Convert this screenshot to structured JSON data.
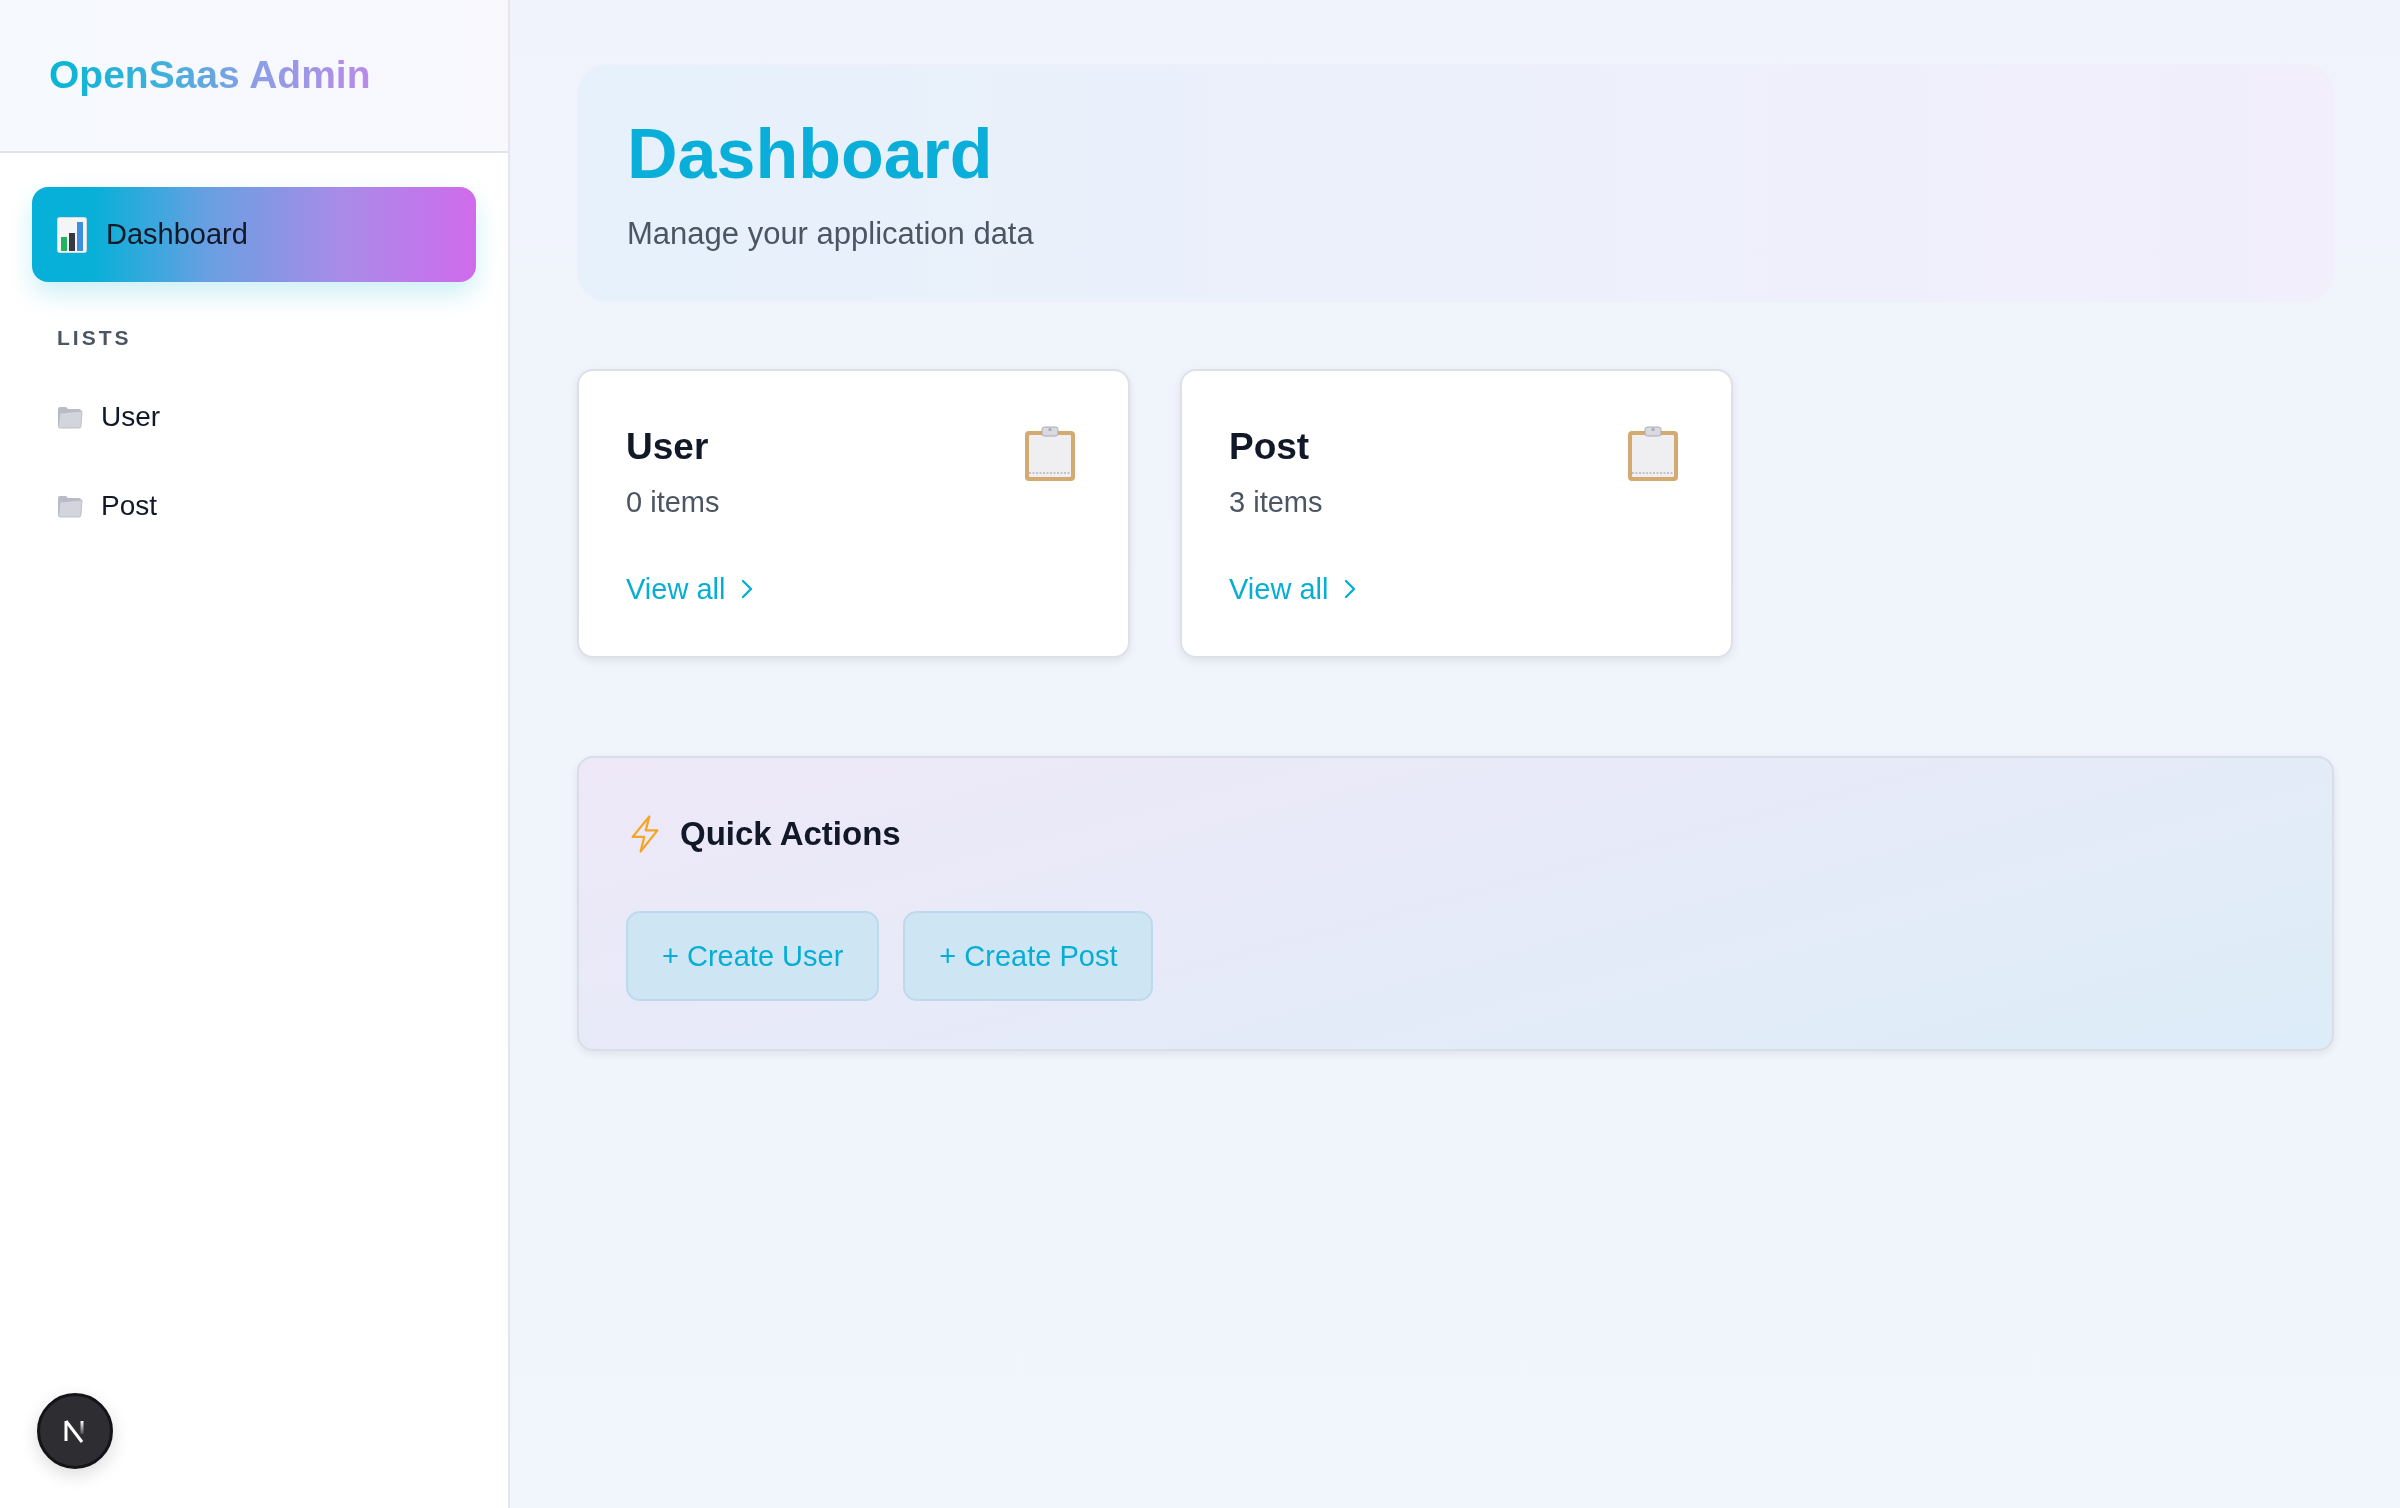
{
  "sidebar": {
    "brand": "OpenSaas Admin",
    "nav": [
      {
        "label": "Dashboard",
        "selected": true
      }
    ],
    "lists": {
      "title": "LISTS",
      "items": [
        {
          "label": "User",
          "selected": false
        },
        {
          "label": "Post",
          "selected": false
        }
      ]
    }
  },
  "header": {
    "title": "Dashboard",
    "subtitle": "Manage your application data"
  },
  "model_cards": [
    {
      "title": "User",
      "count": "0 items",
      "link": "View all"
    },
    {
      "title": "Post",
      "count": "3 items",
      "link": "View all"
    }
  ],
  "quick_actions": {
    "title": "Quick Actions",
    "buttons": [
      "+ Create User",
      "+ Create Post"
    ]
  }
}
